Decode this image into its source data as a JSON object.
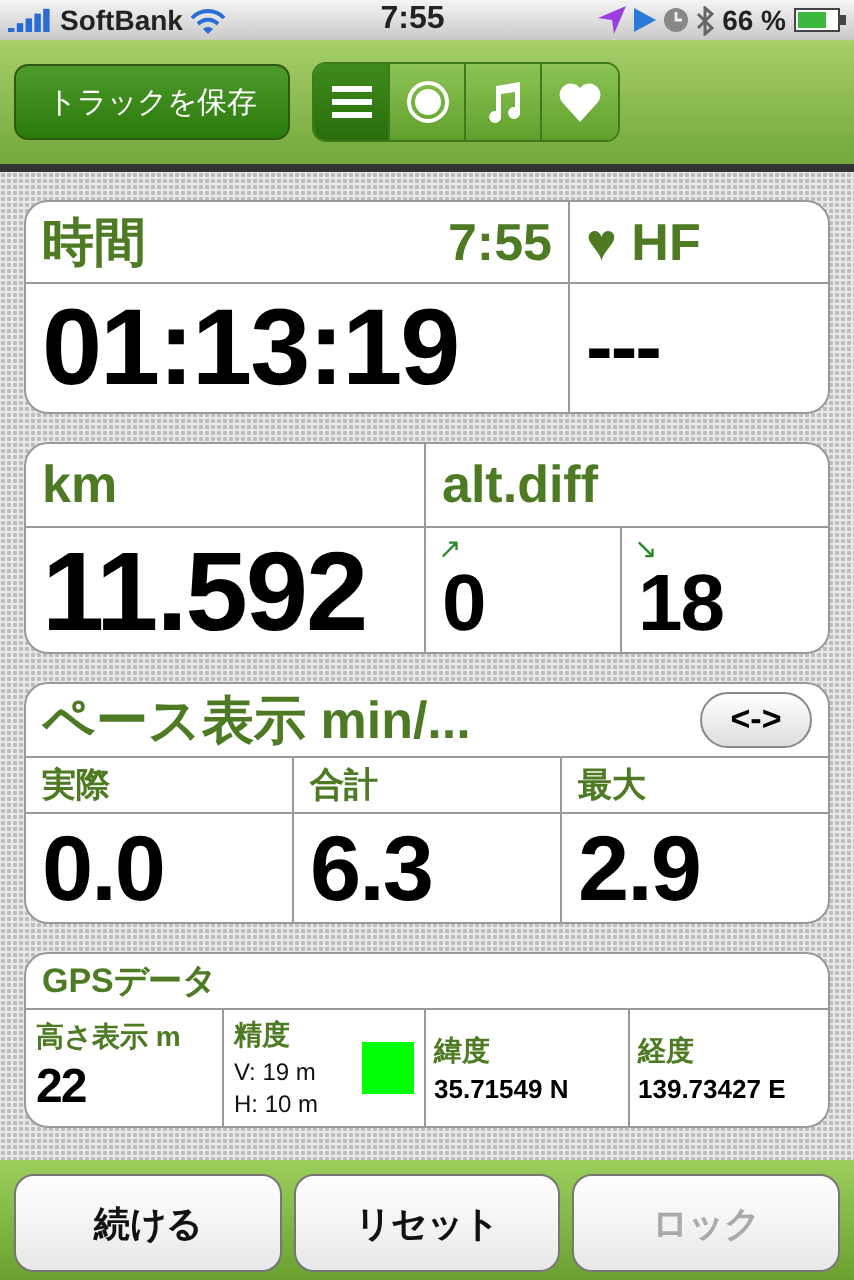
{
  "status_bar": {
    "carrier": "SoftBank",
    "time": "7:55",
    "battery": "66 %"
  },
  "toolbar": {
    "save_button": "トラックを保存",
    "segments": [
      {
        "kind": "list",
        "selected": true
      },
      {
        "kind": "record",
        "selected": false
      },
      {
        "kind": "music",
        "selected": false
      },
      {
        "kind": "heart",
        "selected": false
      }
    ]
  },
  "time_card": {
    "label": "時間",
    "clock": "7:55",
    "value": "01:13:19",
    "hr_label": "♥ HF",
    "hr_value": "---"
  },
  "distance_card": {
    "label": "km",
    "value": "11.592",
    "alt_label": "alt.diff",
    "up_arrow": "↗",
    "up_value": "0",
    "down_arrow": "↘",
    "down_value": "18"
  },
  "pace_card": {
    "title": "ペース表示 min/...",
    "toggle": "<->",
    "columns": [
      {
        "label": "実際",
        "value": "0.0"
      },
      {
        "label": "合計",
        "value": "6.3"
      },
      {
        "label": "最大",
        "value": "2.9"
      }
    ]
  },
  "gps_card": {
    "title": "GPSデータ",
    "altitude_label": "高さ表示 m",
    "altitude": "22",
    "accuracy_label": "精度",
    "vertical": "V: 19 m",
    "horizontal": "H: 10 m",
    "accuracy_indicator": {
      "color": "#00ff00"
    },
    "lat_label": "緯度",
    "lat": "35.71549 N",
    "lon_label": "経度",
    "lon": "139.73427 E"
  },
  "buttons": [
    {
      "label": "続ける",
      "disabled": false
    },
    {
      "label": "リセット",
      "disabled": false
    },
    {
      "label": "ロック",
      "disabled": true
    }
  ]
}
